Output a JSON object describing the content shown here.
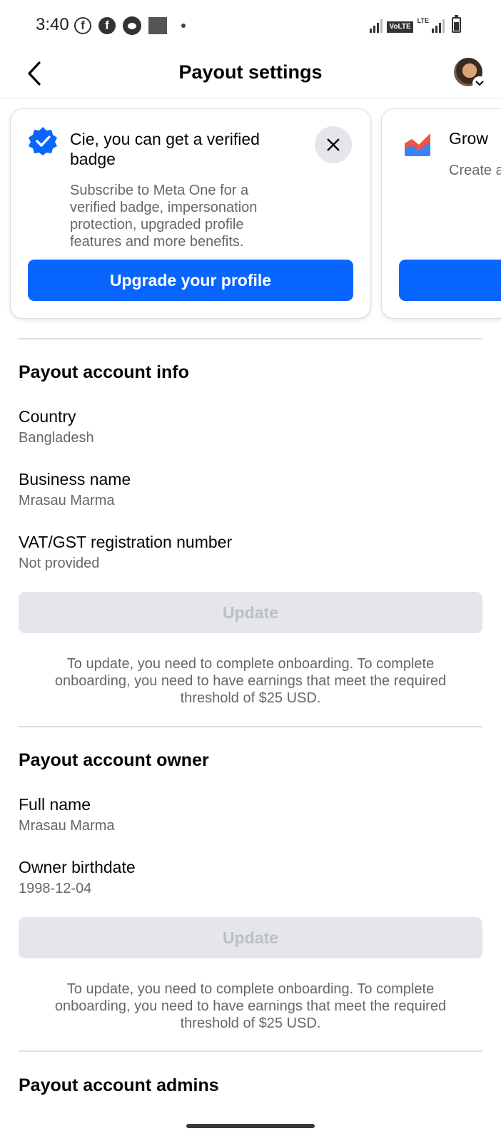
{
  "status_bar": {
    "time": "3:40",
    "volte": "VoLTE",
    "lte": "LTE"
  },
  "header": {
    "title": "Payout settings"
  },
  "promo_cards": [
    {
      "title": "Cie, you can get a verified badge",
      "description": "Subscribe to Meta One for a verified badge, impersonation protection, upgraded profile features and more benefits.",
      "button": "Upgrade your profile"
    },
    {
      "title": "Grow",
      "description": "Create and bu"
    }
  ],
  "payout_account_info": {
    "title": "Payout account info",
    "fields": [
      {
        "label": "Country",
        "value": "Bangladesh"
      },
      {
        "label": "Business name",
        "value": "Mrasau Marma"
      },
      {
        "label": "VAT/GST registration number",
        "value": "Not provided"
      }
    ],
    "update_label": "Update",
    "note": "To update, you need to complete onboarding. To complete onboarding, you need to have earnings that meet the required threshold of $25 USD."
  },
  "payout_account_owner": {
    "title": "Payout account owner",
    "fields": [
      {
        "label": "Full name",
        "value": "Mrasau Marma"
      },
      {
        "label": "Owner birthdate",
        "value": "1998-12-04"
      }
    ],
    "update_label": "Update",
    "note": "To update, you need to complete onboarding. To complete onboarding, you need to have earnings that meet the required threshold of $25 USD."
  },
  "payout_account_admins": {
    "title": "Payout account admins"
  },
  "colors": {
    "accent": "#0866ff",
    "disabled_bg": "#e4e6eb",
    "secondary_text": "#65676b"
  }
}
